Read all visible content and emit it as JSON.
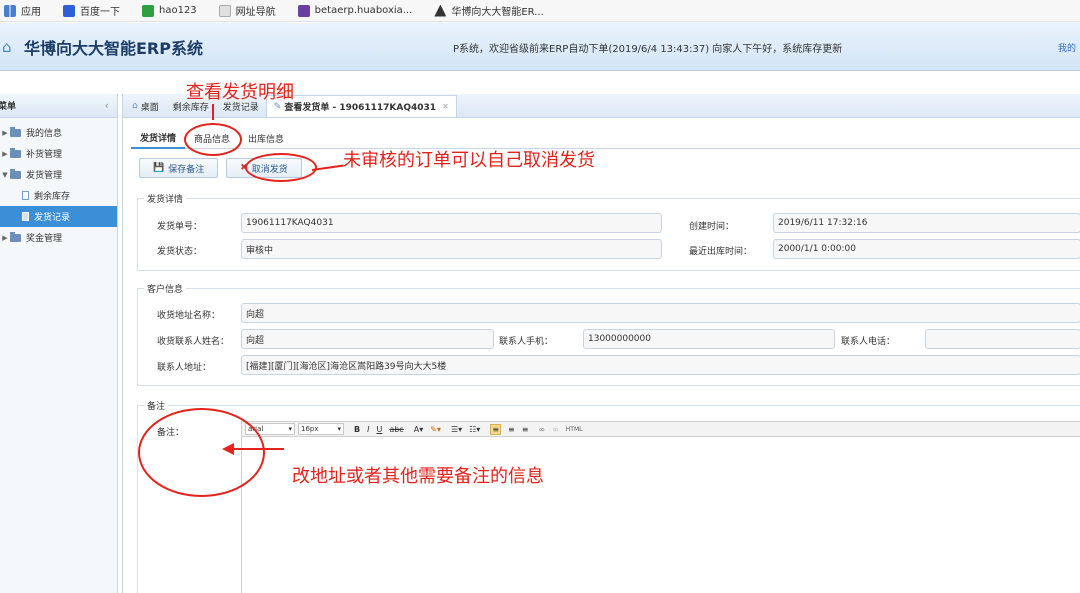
{
  "bookmarks": [
    {
      "label": "应用",
      "icon": "apps-grid-icon"
    },
    {
      "label": "百度一下",
      "icon": "baidu-icon"
    },
    {
      "label": "hao123",
      "icon": "hao123-icon"
    },
    {
      "label": "网址导航",
      "icon": "web-nav-icon"
    },
    {
      "label": "betaerp.huaboxia...",
      "icon": "betaerp-icon"
    },
    {
      "label": "华博向大大智能ER...",
      "icon": "huabo-icon"
    }
  ],
  "header": {
    "title": "华博向大大智能ERP系统",
    "marquee": "P系统，欢迎省级前来ERP自动下单(2019/6/4 13:43:37) 向家人下午好，系统库存更新",
    "right_link": "我的"
  },
  "sidebar": {
    "title": "菜单",
    "items": [
      {
        "label": "我的信息",
        "level": 1,
        "expanded": false
      },
      {
        "label": "补货管理",
        "level": 1,
        "expanded": false
      },
      {
        "label": "发货管理",
        "level": 1,
        "expanded": true
      },
      {
        "label": "剩余库存",
        "level": 2
      },
      {
        "label": "发货记录",
        "level": 2,
        "active": true
      },
      {
        "label": "奖金管理",
        "level": 1,
        "expanded": false
      }
    ]
  },
  "tabs": [
    {
      "label": "桌面",
      "icon": "home-icon"
    },
    {
      "label": "剩余库存"
    },
    {
      "label": "发货记录"
    },
    {
      "label": "查看发货单 - 19061117KAQ4031",
      "icon": "edit-icon",
      "active": true,
      "closable": true
    }
  ],
  "subtabs": [
    {
      "label": "发货详情",
      "active": true
    },
    {
      "label": "商品信息"
    },
    {
      "label": "出库信息"
    }
  ],
  "toolbar": {
    "save_label": "保存备注",
    "cancel_label": "取消发货"
  },
  "shipment": {
    "legend": "发货详情",
    "order_no_label": "发货单号：",
    "order_no": "19061117KAQ4031",
    "created_label": "创建时间：",
    "created": "2019/6/11 17:32:16",
    "status_label": "发货状态：",
    "status": "审核中",
    "last_out_label": "最近出库时间：",
    "last_out": "2000/1/1 0:00:00"
  },
  "customer": {
    "legend": "客户信息",
    "addr_name_label": "收货地址名称：",
    "addr_name": "向超",
    "contact_name_label": "收货联系人姓名：",
    "contact_name": "向超",
    "mobile_label": "联系人手机：",
    "mobile": "13000000000",
    "phone_label": "联系人电话：",
    "phone": "",
    "address_label": "联系人地址：",
    "address": "[福建][厦门][海沧区]海沧区嵩阳路39号向大大5楼"
  },
  "remark": {
    "legend": "备注",
    "label": "备注：",
    "font_family": "arial",
    "font_size": "16px",
    "html_btn": "HTML"
  },
  "annotations": {
    "view_detail": "查看发货明细",
    "cancel_note": "未审核的订单可以自己取消发货",
    "remark_note": "改地址或者其他需要备注的信息"
  }
}
